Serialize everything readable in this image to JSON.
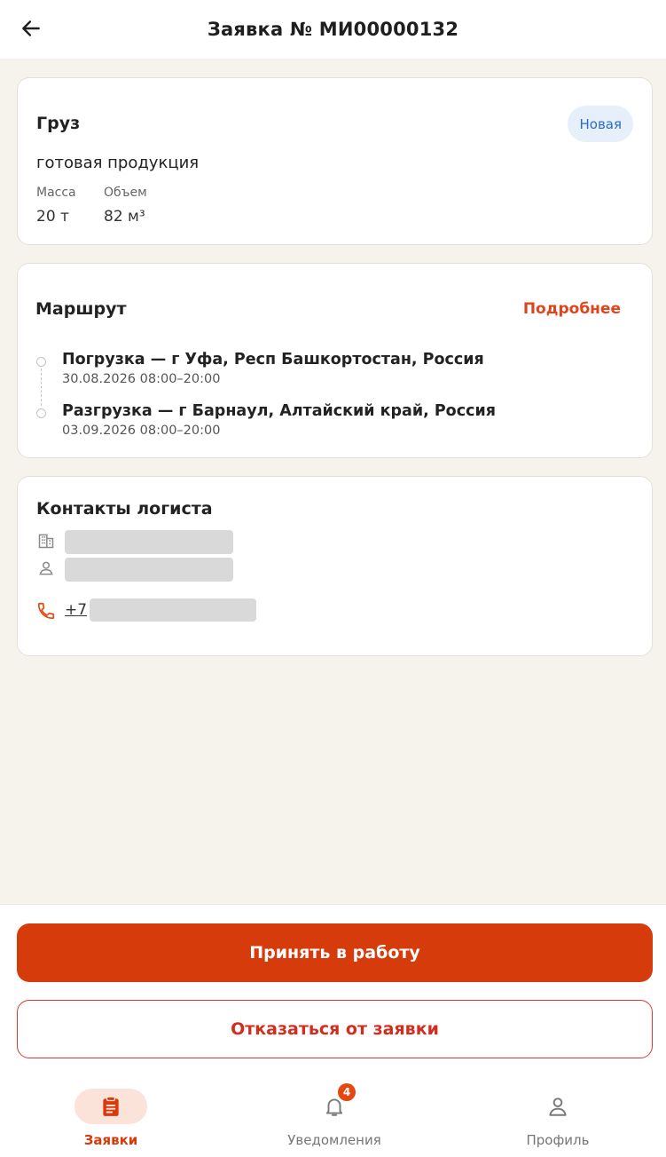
{
  "header": {
    "title": "Заявка № МИ00000132",
    "back_icon": "arrow-left-icon"
  },
  "cargo": {
    "title": "Груз",
    "status": "Новая",
    "name": "готовая продукция",
    "mass_label": "Масса",
    "mass_value": "20 т",
    "volume_label": "Объем",
    "volume_value": "82 м³"
  },
  "route": {
    "title": "Маршрут",
    "more_link": "Подробнее",
    "stops": [
      {
        "title": "Погрузка — г Уфа, Респ Башкортостан, Россия",
        "time": "30.08.2026 08:00–20:00"
      },
      {
        "title": "Разгрузка — г Барнаул, Алтайский край, Россия",
        "time": "03.09.2026 08:00–20:00"
      }
    ]
  },
  "contacts": {
    "title": "Контакты логиста",
    "phone_prefix": "+7",
    "icons": [
      "building-icon",
      "person-icon",
      "phone-icon"
    ]
  },
  "actions": {
    "accept_label": "Принять в работу",
    "decline_label": "Отказаться от заявки"
  },
  "nav": {
    "items": [
      {
        "label": "Заявки",
        "icon": "clipboard-icon",
        "active": true
      },
      {
        "label": "Уведомления",
        "icon": "bell-icon",
        "badge": "4"
      },
      {
        "label": "Профиль",
        "icon": "person-icon"
      }
    ]
  },
  "colors": {
    "accent": "#d63b0c",
    "link": "#e0441b",
    "status_bg": "#e7effb",
    "status_text": "#2e6bc6",
    "background": "#f6f3ed"
  }
}
